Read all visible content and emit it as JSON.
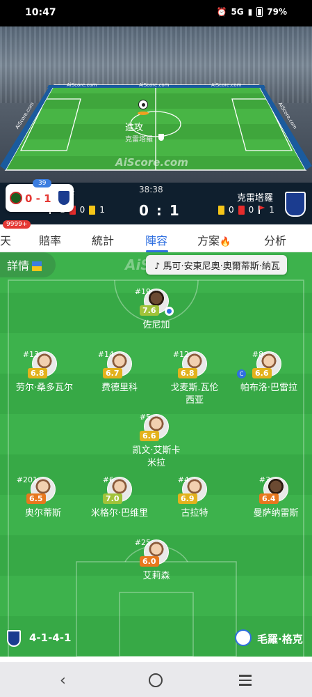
{
  "status": {
    "time": "10:47",
    "network": "5G",
    "battery": "79%",
    "icons": [
      "alarm-icon",
      "signal-icon",
      "battery-icon"
    ]
  },
  "live": {
    "attack_label": "進攻",
    "attack_team": "克雷塔羅",
    "watermark": "AiScore.com",
    "ads": [
      "AiScore.com",
      "AiScore.com",
      "AiScore.com",
      "AiScore.com",
      "AiScore.com"
    ]
  },
  "mini_score": {
    "count": "39",
    "score": "0 - 1"
  },
  "match": {
    "minute": "38:38",
    "score": "0 : 1",
    "away_team": "克雷塔羅",
    "home_stats": {
      "corners": "1",
      "red": "0",
      "yellow": "1"
    },
    "away_stats": {
      "yellow": "0",
      "red": "0",
      "corners": "1"
    },
    "home_partial_name": "F"
  },
  "tabs": {
    "badge": "9999+",
    "items": [
      "天",
      "賠率",
      "統計",
      "陣容",
      "方案",
      "分析"
    ],
    "active": "陣容"
  },
  "lineup": {
    "details_label": "詳情",
    "coach_pill": "馬可·安東尼奧·奧爾蒂斯·納瓦",
    "watermark": "AiS",
    "players": [
      {
        "number": "#19",
        "rating": "7.6",
        "name": "佐尼加"
      },
      {
        "number": "#13",
        "rating": "6.8",
        "name": "劳尔·桑多瓦尔"
      },
      {
        "number": "#14",
        "rating": "6.7",
        "name": "费德里科"
      },
      {
        "number": "#12",
        "rating": "6.8",
        "name": "戈麦斯.瓦伦西亚"
      },
      {
        "number": "#8",
        "rating": "6.6",
        "name": "帕布洛·巴雷拉",
        "captain": "C"
      },
      {
        "number": "#5",
        "rating": "6.6",
        "name": "凯文·艾斯卡米拉"
      },
      {
        "number": "#201",
        "rating": "6.5",
        "name": "奥尔蒂斯"
      },
      {
        "number": "#6",
        "rating": "7.0",
        "name": "米格尔·巴维里"
      },
      {
        "number": "#4",
        "rating": "6.9",
        "name": "古拉特"
      },
      {
        "number": "#3",
        "rating": "6.4",
        "name": "曼萨纳雷斯"
      },
      {
        "number": "#25",
        "rating": "6.0",
        "name": "艾莉森"
      }
    ],
    "formation": "4-1-4-1",
    "coach": "毛羅·格克"
  },
  "colors": {
    "accent": "#2f6fe0",
    "pitch": "#3bb04a",
    "header_bg": "#0f1f2e"
  }
}
